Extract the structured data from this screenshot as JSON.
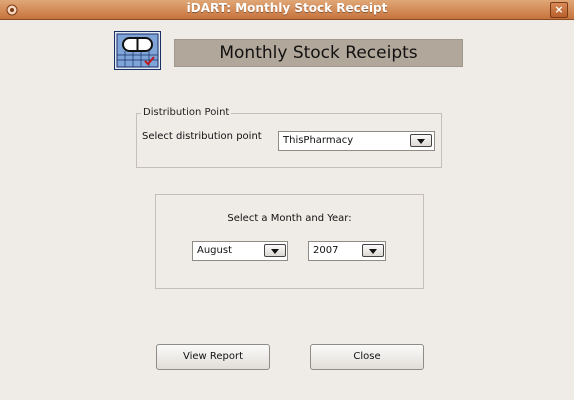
{
  "window": {
    "title": "iDART: Monthly Stock Receipt",
    "close_label": "×"
  },
  "header": {
    "title": "Monthly Stock Receipts",
    "icon": "pill-calendar-icon"
  },
  "distribution": {
    "legend": "Distribution Point",
    "label": "Select distribution point",
    "value": "ThisPharmacy"
  },
  "period": {
    "label": "Select a Month and Year:",
    "month": "August",
    "year": "2007"
  },
  "buttons": {
    "view_report": "View Report",
    "close": "Close"
  }
}
